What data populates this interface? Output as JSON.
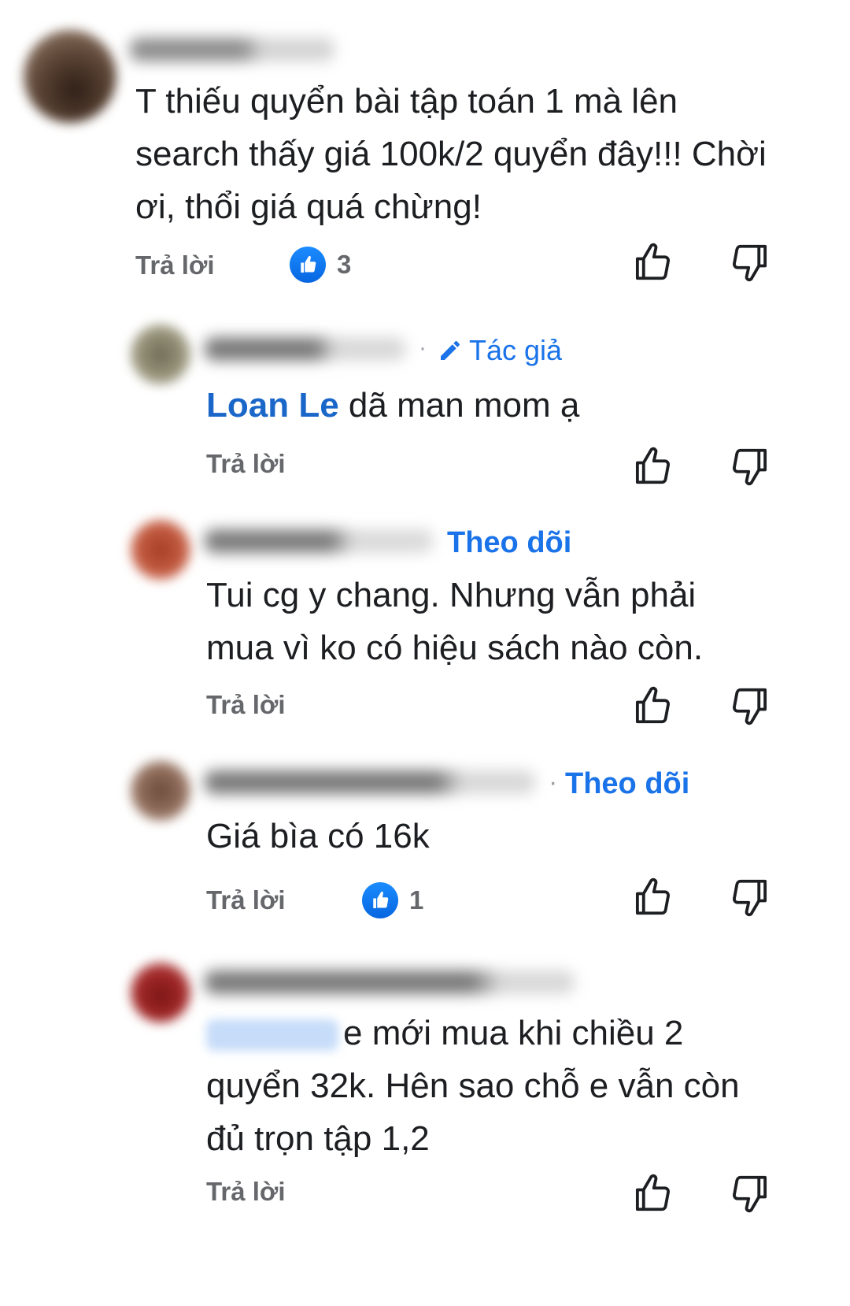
{
  "comments": [
    {
      "text": "T thiếu quyển bài tập toán 1 mà lên search thấy giá 100k/2 quyển đây!!! Chời ơi, thổi giá quá chừng!",
      "reply_label": "Trả lời",
      "reaction_count": "3",
      "reaction_icon": "like-reaction-icon"
    },
    {
      "tag_label": "Tác giả",
      "tag_icon": "pencil-icon",
      "mention": "Loan Le",
      "text": " dã man mom ạ",
      "reply_label": "Trả lời"
    },
    {
      "follow_label": "Theo dõi",
      "text": "Tui cg y chang. Nhưng vẫn phải mua vì ko có hiệu sách nào còn.",
      "reply_label": "Trả lời"
    },
    {
      "follow_label": "Theo dõi",
      "text": "Giá bìa có 16k",
      "reply_label": "Trả lời",
      "reaction_count": "1",
      "reaction_icon": "like-reaction-icon"
    },
    {
      "text": "e mới mua khi chiều 2 quyển 32k. Hên sao chỗ e vẫn còn đủ trọn tập 1,2",
      "reply_label": "Trả lời"
    }
  ],
  "colors": {
    "accent": "#1a73e8",
    "reaction_blue": "#0766e0",
    "secondary_text": "#65676b"
  }
}
